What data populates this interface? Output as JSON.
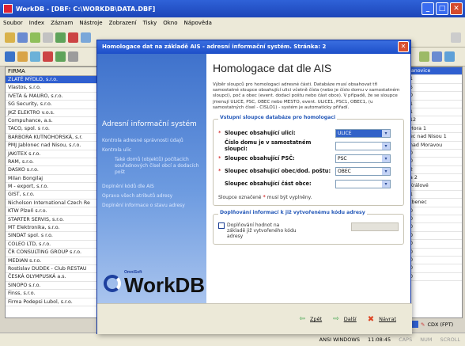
{
  "window": {
    "title": "WorkDB - [DBF: C:\\WORKDB\\DATA.DBF]"
  },
  "menu": [
    "Soubor",
    "Index",
    "Záznam",
    "Nástroje",
    "Zobrazení",
    "Tisky",
    "Okno",
    "Nápověda"
  ],
  "left_list": {
    "header": "FIRMA",
    "rows": [
      "ZLATÉ MÝDLO, s.r.o.",
      "Vlastos, s.r.o.",
      "IVETA & MAURO, s.r.o.",
      "SG Security, s.r.o.",
      "JKZ ELEKTRO v.o.s.",
      "Compuhance, a.s.",
      "TACO, spol. s r.o.",
      "BARBORA KUTNOHORSKÁ, s.r.",
      "PMJ Jablonec nad Nisou, s.r.o.",
      "JAKITEX s.r.o.",
      "RAM, s.r.o.",
      "DASKO s.r.o.",
      "Milan Bongilaj",
      "M - export, s.r.o.",
      "GIST, s.r.o.",
      "Nicholson International Czech Re",
      "KTW Plzeň s.r.o.",
      "STARTER SERVIS, s.r.o.",
      "MT Elektronika, s.r.o.",
      "SINDAT spol. s r.o.",
      "COLEO LTD, s.r.o.",
      "ČR CONSULTING GROUP s.r.o.",
      "MEDIAN s.r.o.",
      "Rostislav DUDEK - Club RESTAU",
      "ČESKÁ OLYMPUSKÁ a.s.",
      "SINOPO s.r.o.",
      "Finss, s.r.o.",
      "Firma Podepsi Lubol, s.r.o."
    ]
  },
  "right_list": {
    "rows": [
      "Janovice",
      "1",
      "5",
      "0",
      "1",
      "1",
      "12",
      "Hora 1",
      "ec nad Nisou 1",
      "nad Moravou",
      "0",
      "0",
      "2",
      "a 2",
      "Králové",
      "1",
      "tbenec",
      "0",
      "0",
      "0",
      "0",
      "0",
      "0",
      "0",
      "0",
      "0"
    ]
  },
  "dialog": {
    "title": "Homologace dat na základě AIS - adresní informační systém. Stránka: 2",
    "close_glyph": "✕",
    "side": {
      "title": "Adresní informační systém",
      "items": [
        "Kontrola adresné správnosti údajů",
        "Kontrola ulic",
        "Také domů (objektů) počítacích souřadnových čísel obcí a dodacích pošt",
        "Doplnění kódů dle AIS",
        "Oprava všech atributů adresy",
        "Doplnění informace o stavu adresy"
      ],
      "logo_small": "OmniSoft",
      "logo": "WorkDB"
    },
    "heading": "Homologace dat dle AIS",
    "description": "Výběr sloupců pro homologaci adresné části. Databáze musí obsahovat tři samostatné sloupce obsahující ulici včetně čísla (nebo je číslo domu v samostatném sloupci), poč a obec (event. dodací poštu nebo část obce). V případě, že se sloupce jmenují ULICE, PSC, OBEC nebo MESTO, event. ULICE1, PSC1, OBEC1, (u samostatných čísel - CISLO1) - systém je automaticky přiřadí.",
    "group1": {
      "title": "Vstupní sloupce databáze pro homologaci",
      "fields": [
        {
          "required": true,
          "label": "Sloupec obsahující ulici:",
          "value": "ULICE",
          "selected": true
        },
        {
          "required": false,
          "label": "Číslo domu je v samostatném sloupci:",
          "value": "",
          "selected": false
        },
        {
          "required": true,
          "label": "Sloupec obsahující PSČ:",
          "value": "PSC",
          "selected": false
        },
        {
          "required": true,
          "label": "Sloupec obsahující obec/dod. poštu:",
          "value": "OBEC",
          "selected": false
        },
        {
          "required": false,
          "label": "Sloupec obsahující část obce:",
          "value": "",
          "selected": false
        }
      ],
      "note_pre": "Sloupce označené",
      "note_post": "musí být vyplněny."
    },
    "group2": {
      "title": "Doplňování informací k již vytvořenému kódu adresy",
      "checkbox_label": "Doplňování hodnot na základě již vytvořeného kódu adresy"
    },
    "buttons": {
      "back": "Zpět",
      "next": "Další",
      "cancel": "Návrat"
    }
  },
  "status": {
    "cdx": "CDX (FPT)",
    "encoding": "ANSI WINDOWS",
    "time": "11:08:45",
    "ind1": "CAPS",
    "ind2": "NUM",
    "ind3": "SCROLL"
  },
  "colors": {
    "titlebar": "#2f62d8",
    "selection": "#2f5fd0",
    "dialog_side": "#3f72cc",
    "group_title": "#2458b8",
    "required": "#cc0000"
  }
}
